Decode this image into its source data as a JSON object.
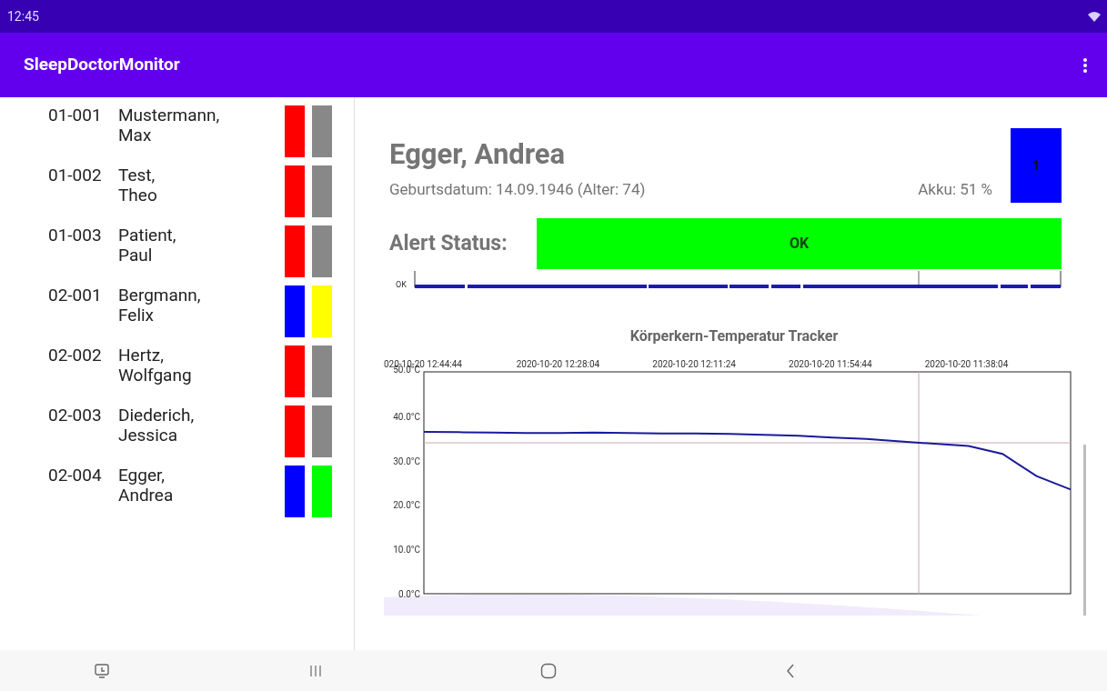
{
  "status_bar": {
    "time": "12:45"
  },
  "app_bar": {
    "title": "SleepDoctorMonitor"
  },
  "patients": [
    {
      "id": "01-001",
      "last_name": "Mustermann,",
      "first_name": "Max",
      "indicators": [
        {
          "color": "#ff0000"
        },
        {
          "color": "#888888"
        }
      ]
    },
    {
      "id": "01-002",
      "last_name": "Test,",
      "first_name": "Theo",
      "indicators": [
        {
          "color": "#ff0000"
        },
        {
          "color": "#888888"
        }
      ]
    },
    {
      "id": "01-003",
      "last_name": "Patient,",
      "first_name": "Paul",
      "indicators": [
        {
          "color": "#ff0000"
        },
        {
          "color": "#888888"
        }
      ]
    },
    {
      "id": "02-001",
      "last_name": "Bergmann,",
      "first_name": "Felix",
      "indicators": [
        {
          "color": "#0000ff"
        },
        {
          "color": "#ffff00"
        }
      ]
    },
    {
      "id": "02-002",
      "last_name": "Hertz,",
      "first_name": "Wolfgang",
      "indicators": [
        {
          "color": "#ff0000"
        },
        {
          "color": "#888888"
        }
      ]
    },
    {
      "id": "02-003",
      "last_name": "Diederich,",
      "first_name": "Jessica",
      "indicators": [
        {
          "color": "#ff0000"
        },
        {
          "color": "#888888"
        }
      ]
    },
    {
      "id": "02-004",
      "last_name": "Egger,",
      "first_name": "Andrea",
      "indicators": [
        {
          "color": "#0000ff"
        },
        {
          "color": "#00ff00"
        }
      ]
    }
  ],
  "detail": {
    "name": "Egger, Andrea",
    "birth": "Geburtsdatum: 14.09.1946 (Alter: 74)",
    "battery": "Akku: 51 %",
    "device_button": {
      "label": "1",
      "color": "#0000ff"
    },
    "alert_label": "Alert Status:",
    "alert": {
      "value": "OK",
      "color": "#00ff00"
    },
    "timeline_label": "OK"
  },
  "chart": {
    "chart_data": {
      "type": "line",
      "title": "Körperkern-Temperatur Tracker",
      "categories": [
        "020-10-20 12:44:44",
        null,
        null,
        null,
        "2020-10-20 12:28:04",
        null,
        null,
        null,
        "2020-10-20 12:11:24",
        null,
        null,
        null,
        "2020-10-20 11:54:44",
        null,
        null,
        null,
        "2020-10-20 11:38:04",
        null,
        null,
        null
      ],
      "series": [
        {
          "color": "#1a1a9c",
          "values": [
            36.5,
            36.4,
            36.3,
            36.2,
            36.2,
            36.3,
            36.2,
            36.1,
            36.1,
            36.0,
            35.8,
            35.6,
            35.2,
            34.9,
            34.3,
            33.8,
            33.3,
            31.5,
            26.5,
            23.5
          ]
        }
      ],
      "ylim": [
        0,
        50
      ],
      "yticks": [
        {
          "value": 0,
          "label": "0.0°C"
        },
        {
          "value": 10,
          "label": "10.0°C"
        },
        {
          "value": 20,
          "label": "20.0°C"
        },
        {
          "value": 30,
          "label": "30.0°C"
        },
        {
          "value": 40,
          "label": "40.0°C"
        },
        {
          "value": 50,
          "label": "50.0°C"
        }
      ]
    }
  }
}
